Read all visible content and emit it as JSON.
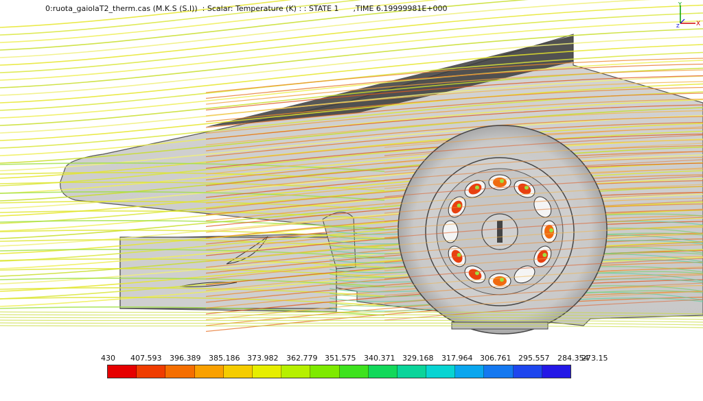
{
  "header": {
    "title": "0:ruota_gaiolaT2_therm.cas (M.K.S (S.I))  : Scalar: Temperature (K) : : STATE 1      ,TIME 6.19999981E+000"
  },
  "axis_triad": {
    "y_label": "Y",
    "x_label": "X",
    "z_label": "Z"
  },
  "legend": {
    "labels": [
      "430",
      "407.593",
      "396.389",
      "385.186",
      "373.982",
      "362.779",
      "351.575",
      "340.371",
      "329.168",
      "317.964",
      "306.761",
      "295.557",
      "284.354",
      "273.15"
    ],
    "colors": [
      "#e60000",
      "#f03c00",
      "#f56e00",
      "#f9a000",
      "#f5cc00",
      "#e6ee00",
      "#b6f000",
      "#7eea00",
      "#3ee21e",
      "#12d85a",
      "#0ad49a",
      "#08d4d2",
      "#0aa6ee",
      "#1478f0",
      "#1e46ee",
      "#2418e6"
    ]
  }
}
